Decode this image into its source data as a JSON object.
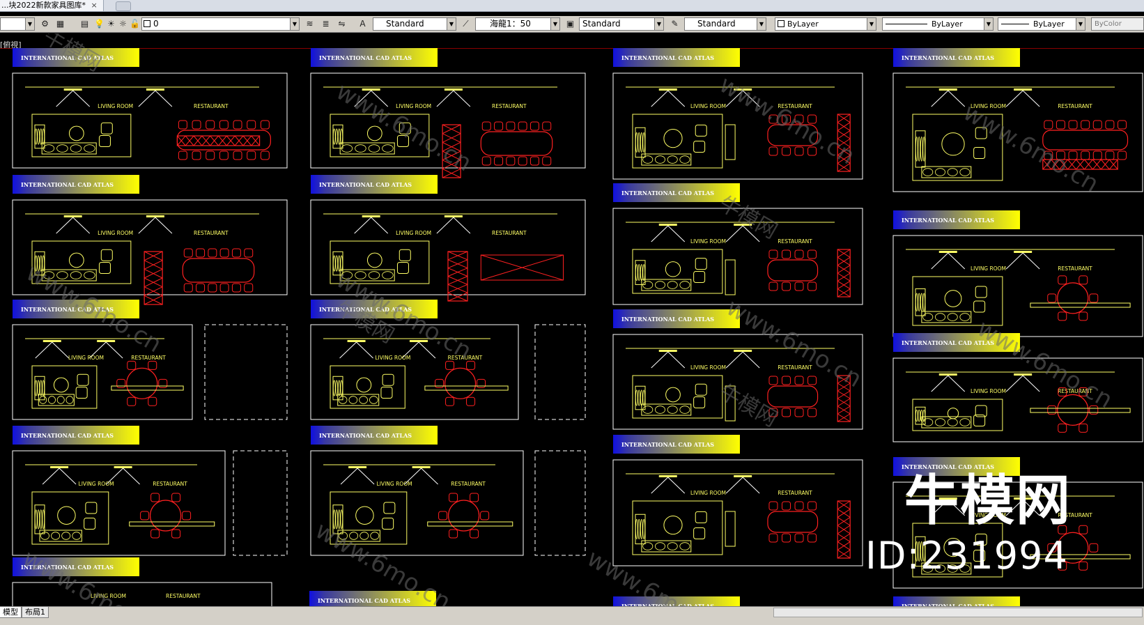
{
  "window": {
    "doc_tab_title": "...块2022新款家具图库*",
    "doc_tab_close": "×"
  },
  "toolbar": {
    "layer_value": "0",
    "text_style": "Standard",
    "dim_scale": "海龍1：50",
    "dim_style": "Standard",
    "table_style": "Standard",
    "color_control": "ByLayer",
    "linetype_control": "ByLayer",
    "lineweight_control": "ByLayer",
    "plot_style": "ByColor"
  },
  "canvas": {
    "view_label": "[俯視]",
    "panel_header": "INTERNATIONAL CAD ATLAS",
    "living_room_label": "LIVING ROOM",
    "restaurant_label": "RESTAURANT",
    "watermark_url": "www.6mo.cn",
    "watermark_brand": "牛模网",
    "watermark_big": "牛模网",
    "watermark_id": "ID:231994"
  },
  "bottom": {
    "model_tab": "模型",
    "layout_tab": "布局1"
  },
  "colors": {
    "background": "#000000",
    "cad_yellow": "#ffff66",
    "cad_red": "#ff2020",
    "cad_white": "#ffffff",
    "header_gradient_start": "#1010e0",
    "header_gradient_end": "#ffff00"
  }
}
